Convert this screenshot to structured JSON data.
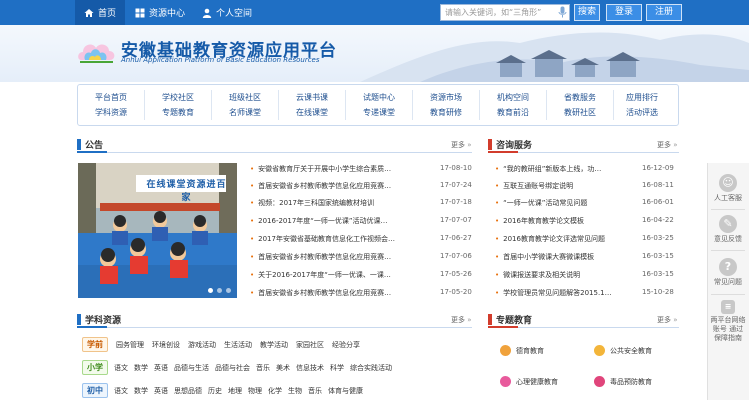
{
  "topbar": {
    "nav": [
      {
        "label": "首页",
        "icon": "home-icon"
      },
      {
        "label": "资源中心",
        "icon": "grid-icon"
      },
      {
        "label": "个人空间",
        "icon": "user-icon"
      }
    ],
    "search_placeholder": "请输入关键词，如“三角形”",
    "search_button": "搜索",
    "login_button": "登录",
    "register_button": "注册"
  },
  "header": {
    "title": "安徽基础教育资源应用平台",
    "subtitle": "Anhui Application Platform of Basic Education Resources"
  },
  "mainnav": [
    [
      "平台首页",
      "学科资源"
    ],
    [
      "学校社区",
      "专题教育"
    ],
    [
      "班级社区",
      "名师课堂"
    ],
    [
      "云课书课",
      "在线课堂"
    ],
    [
      "试题中心",
      "专递课堂"
    ],
    [
      "资源市场",
      "教育研修"
    ],
    [
      "机构空间",
      "教育前沿"
    ],
    [
      "省教服务",
      "教研社区"
    ],
    [
      "应用排行",
      "活动评选"
    ]
  ],
  "announce": {
    "title": "公告",
    "more": "更多",
    "photo_caption": "在线课堂资源进百家",
    "items": [
      {
        "text": "安徽省教育厅关于开展中小学生综合素质…",
        "date": "17-08-10"
      },
      {
        "text": "首届安徽省乡村教师教学信息化应用竞赛…",
        "date": "17-07-24"
      },
      {
        "text": "视频：2017年三科国家统编教材培训",
        "date": "17-07-18"
      },
      {
        "text": "2016-2017年度“一师一优课”活动优课…",
        "date": "17-07-07"
      },
      {
        "text": "2017年安徽省基础教育信息化工作视频会…",
        "date": "17-06-27"
      },
      {
        "text": "首届安徽省乡村教师教学信息化应用竞赛…",
        "date": "17-07-06"
      },
      {
        "text": "关于2016-2017年度“一师一优课、一课…",
        "date": "17-05-26"
      },
      {
        "text": "首届安徽省乡村教师教学信息化应用竞赛…",
        "date": "17-05-20"
      }
    ]
  },
  "consult": {
    "title": "咨询服务",
    "more": "更多",
    "items": [
      {
        "text": "“我的教研组”新版本上线，功…",
        "date": "16-12-09"
      },
      {
        "text": "互联互通账号绑定说明",
        "date": "16-08-11"
      },
      {
        "text": "“一师一优课”活动常见问题",
        "date": "16-06-01"
      },
      {
        "text": "2016年教育教学论文模板",
        "date": "16-04-22"
      },
      {
        "text": "2016教育教学论文评选常见问题",
        "date": "16-03-25"
      },
      {
        "text": "首届中小学微课大赛微课模板",
        "date": "16-03-15"
      },
      {
        "text": "微课报送要求及相关说明",
        "date": "16-03-15"
      },
      {
        "text": "学校管理员常见问题解答2015.1…",
        "date": "15-10-28"
      }
    ]
  },
  "subjects": {
    "title": "学科资源",
    "more": "更多",
    "rows": [
      {
        "tag": "学前",
        "items": [
          "园务管理",
          "环境创设",
          "游戏活动",
          "生活活动",
          "教学活动",
          "家园社区",
          "经验分享"
        ]
      },
      {
        "tag": "小学",
        "items": [
          "语文",
          "数学",
          "英语",
          "品德与生活",
          "品德与社会",
          "音乐",
          "美术",
          "信息技术",
          "科学",
          "综合实践活动"
        ]
      },
      {
        "tag": "初中",
        "items": [
          "语文",
          "数学",
          "英语",
          "思想品德",
          "历史",
          "地理",
          "物理",
          "化学",
          "生物",
          "音乐",
          "体育与健康"
        ]
      }
    ]
  },
  "topics": {
    "title": "专题教育",
    "more": "更多",
    "items": [
      {
        "label": "德育教育",
        "color": "#f0a23c"
      },
      {
        "label": "公共安全教育",
        "color": "#f3b53a"
      },
      {
        "label": "心理健康教育",
        "color": "#e85a9c"
      },
      {
        "label": "毒品预防教育",
        "color": "#e0457b"
      }
    ]
  },
  "sidebar": [
    {
      "label": "人工客服",
      "icon": "customer-service-icon"
    },
    {
      "label": "意见反馈",
      "icon": "feedback-icon"
    },
    {
      "label": "常见问题",
      "icon": "question-icon"
    },
    {
      "label": "两平台网络账号 通过保障指南",
      "icon": "guide-icon"
    }
  ],
  "colors": {
    "brand": "#1f6fc4",
    "accent_orange": "#e8700c"
  }
}
